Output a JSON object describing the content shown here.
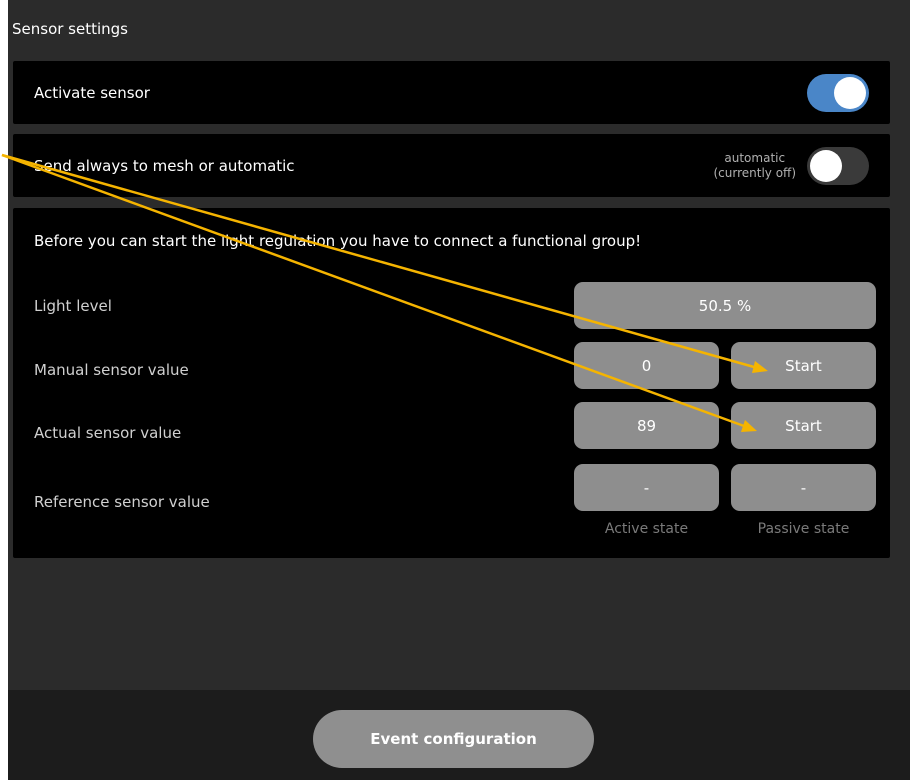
{
  "page": {
    "title": "Sensor settings"
  },
  "activate_sensor": {
    "label": "Activate sensor",
    "enabled": true
  },
  "mesh": {
    "label": "Send always to mesh or automatic",
    "caption_line1": "automatic",
    "caption_line2": "(currently off)",
    "enabled": false
  },
  "regulation": {
    "warning": "Before you can start the light regulation you have to connect a functional group!",
    "light_level": {
      "label": "Light level",
      "value": "50.5 %"
    },
    "manual_sensor": {
      "label": "Manual sensor value",
      "value": "0",
      "button": "Start"
    },
    "actual_sensor": {
      "label": "Actual sensor value",
      "value": "89",
      "button": "Start"
    },
    "reference_sensor": {
      "label": "Reference sensor value",
      "active_value": "-",
      "passive_value": "-"
    },
    "columns": {
      "active": "Active state",
      "passive": "Passive state"
    }
  },
  "footer": {
    "event_button": "Event configuration"
  },
  "colors": {
    "toggle_on": "#4a86c8",
    "annotation_arrow": "#f5b400",
    "box_fill": "#8e8e8e"
  }
}
